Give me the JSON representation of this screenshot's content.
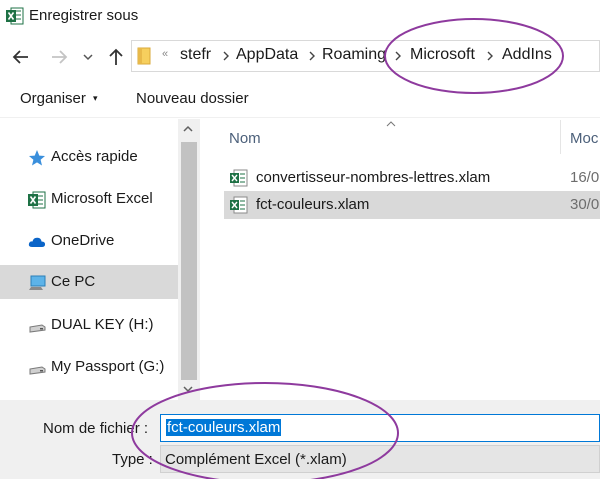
{
  "window": {
    "title": "Enregistrer sous",
    "icon": "excel-icon"
  },
  "breadcrumb": {
    "overflow": "«",
    "items": [
      "stefr",
      "AppData",
      "Roaming",
      "Microsoft",
      "AddIns"
    ]
  },
  "toolbar": {
    "organise_label": "Organiser",
    "organise_caret": "▾",
    "new_folder_label": "Nouveau dossier"
  },
  "sidebar": {
    "items": [
      {
        "label": "Accès rapide",
        "icon": "star-icon"
      },
      {
        "label": "Microsoft Excel",
        "icon": "excel-icon"
      },
      {
        "label": "OneDrive",
        "icon": "cloud-icon"
      },
      {
        "label": "Ce PC",
        "icon": "computer-icon",
        "selected": true
      },
      {
        "label": "DUAL KEY (H:)",
        "icon": "drive-icon"
      },
      {
        "label": "My Passport (G:)",
        "icon": "drive-icon"
      }
    ]
  },
  "filelist": {
    "columns": [
      "Nom",
      "Moc"
    ],
    "files": [
      {
        "name": "convertisseur-nombres-lettres.xlam",
        "date": "16/0",
        "selected": false
      },
      {
        "name": "fct-couleurs.xlam",
        "date": "30/0",
        "selected": true
      }
    ]
  },
  "form": {
    "filename_label": "Nom de fichier :",
    "filename_value": "fct-couleurs.xlam",
    "type_label": "Type :",
    "type_value": "Complément Excel (*.xlam)"
  },
  "colors": {
    "accent": "#0078d7",
    "annotation": "#8e3a9e",
    "excel_green": "#1e7145",
    "selection": "#d9d9d9"
  }
}
